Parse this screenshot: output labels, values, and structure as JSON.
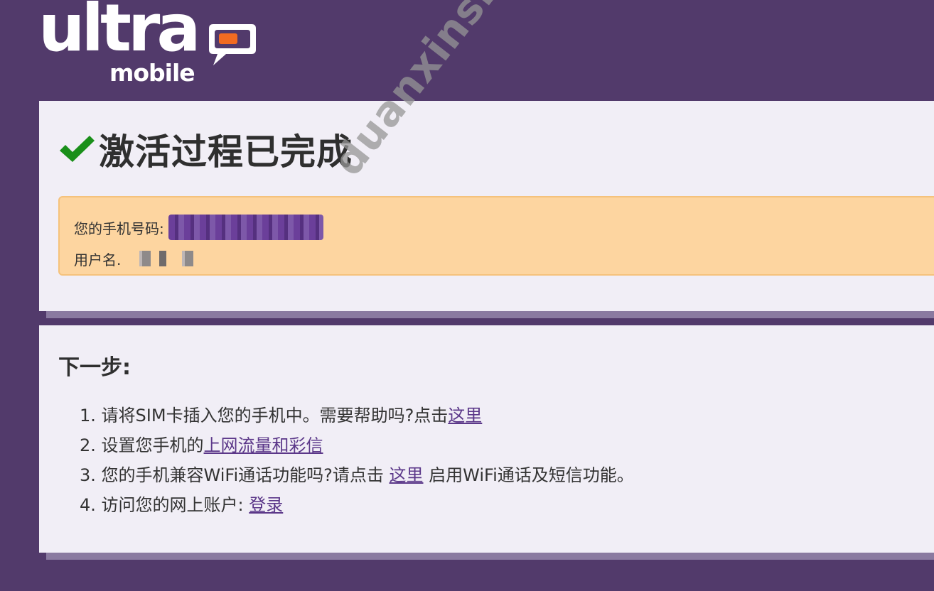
{
  "logo": {
    "ultra": "ultra",
    "mobile": "mobile"
  },
  "activation": {
    "title": "激活过程已完成",
    "phone_label": "您的手机号码:",
    "username_label": "用户名."
  },
  "next_steps": {
    "title": "下一步:",
    "steps": [
      {
        "num": "1.",
        "text": "请将SIM卡插入您的手机中。需要帮助吗?点击",
        "link": "这里"
      },
      {
        "num": "2.",
        "text": "设置您手机的",
        "link": "上网流量和彩信"
      },
      {
        "num": "3.",
        "text": "您的手机兼容WiFi通话功能吗?请点击 ",
        "link": "这里",
        "after": " 启用WiFi通话及短信功能。"
      },
      {
        "num": "4.",
        "text": "访问您的网上账户: ",
        "link": "登录"
      }
    ]
  },
  "watermark": "duanxinshou.com",
  "colors": {
    "background": "#523a6b",
    "panel": "#f1eef6",
    "info_box": "#fdd5a0",
    "check": "#1a8f1a",
    "link": "#5b3789",
    "logo_bubble": "#f26b21"
  }
}
